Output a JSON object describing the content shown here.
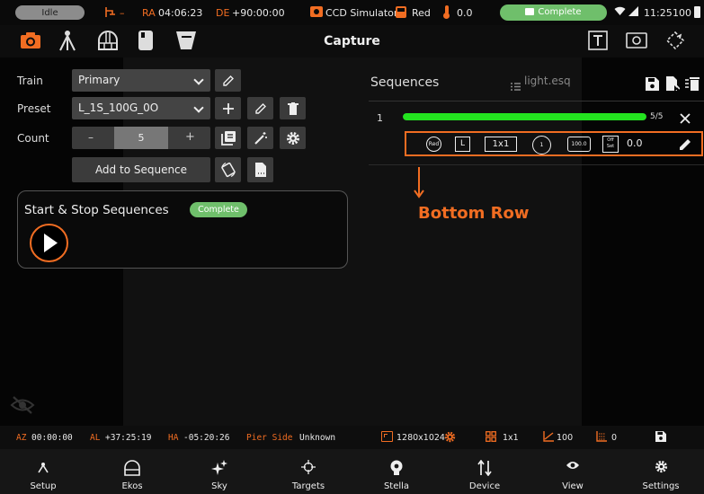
{
  "statusbar": {
    "idle": "Idle",
    "mount_dash": "–",
    "ra_label": "RA",
    "ra_value": "04:06:23",
    "de_label": "DE",
    "de_value": "+90:00:00",
    "camera": "CCD Simulator",
    "filter": "Red",
    "temperature": "0.0",
    "capture_status": "Complete",
    "clock": "11:25",
    "battery": "100"
  },
  "header": {
    "title": "Capture"
  },
  "form": {
    "train_label": "Train",
    "train_value": "Primary",
    "preset_label": "Preset",
    "preset_value": "L_1S_100G_0O",
    "count_label": "Count",
    "count_minus": "–",
    "count_value": "5",
    "count_plus": "+",
    "add_label": "Add to Sequence"
  },
  "startstop": {
    "title": "Start & Stop Sequences",
    "status": "Complete"
  },
  "sequences": {
    "title": "Sequences",
    "file": "light.esq",
    "rows": [
      {
        "index": "1",
        "progress": 1.0,
        "progress_text": "5/5",
        "filter": "Red",
        "type": "L",
        "binning": "1x1",
        "exposure": "1",
        "gain": "100.0",
        "offset_top": "Off",
        "offset_bottom": "Set",
        "offset_value": "0.0"
      }
    ]
  },
  "annotation": {
    "text": "Bottom Row"
  },
  "bottomstatus": {
    "az_label": "AZ",
    "az_value": "00:00:00",
    "al_label": "AL",
    "al_value": "+37:25:19",
    "ha_label": "HA",
    "ha_value": "-05:20:26",
    "pier_label": "Pier Side",
    "pier_value": "Unknown",
    "frame": "1280x1024",
    "bin": "1x1",
    "gain": "100",
    "offset": "0"
  },
  "nav": [
    "Setup",
    "Ekos",
    "Sky",
    "Targets",
    "Stella",
    "Device",
    "View",
    "Settings"
  ],
  "colors": {
    "accent": "#f16d22",
    "progress": "#23e31f",
    "complete_pill": "#6fbf6b"
  }
}
